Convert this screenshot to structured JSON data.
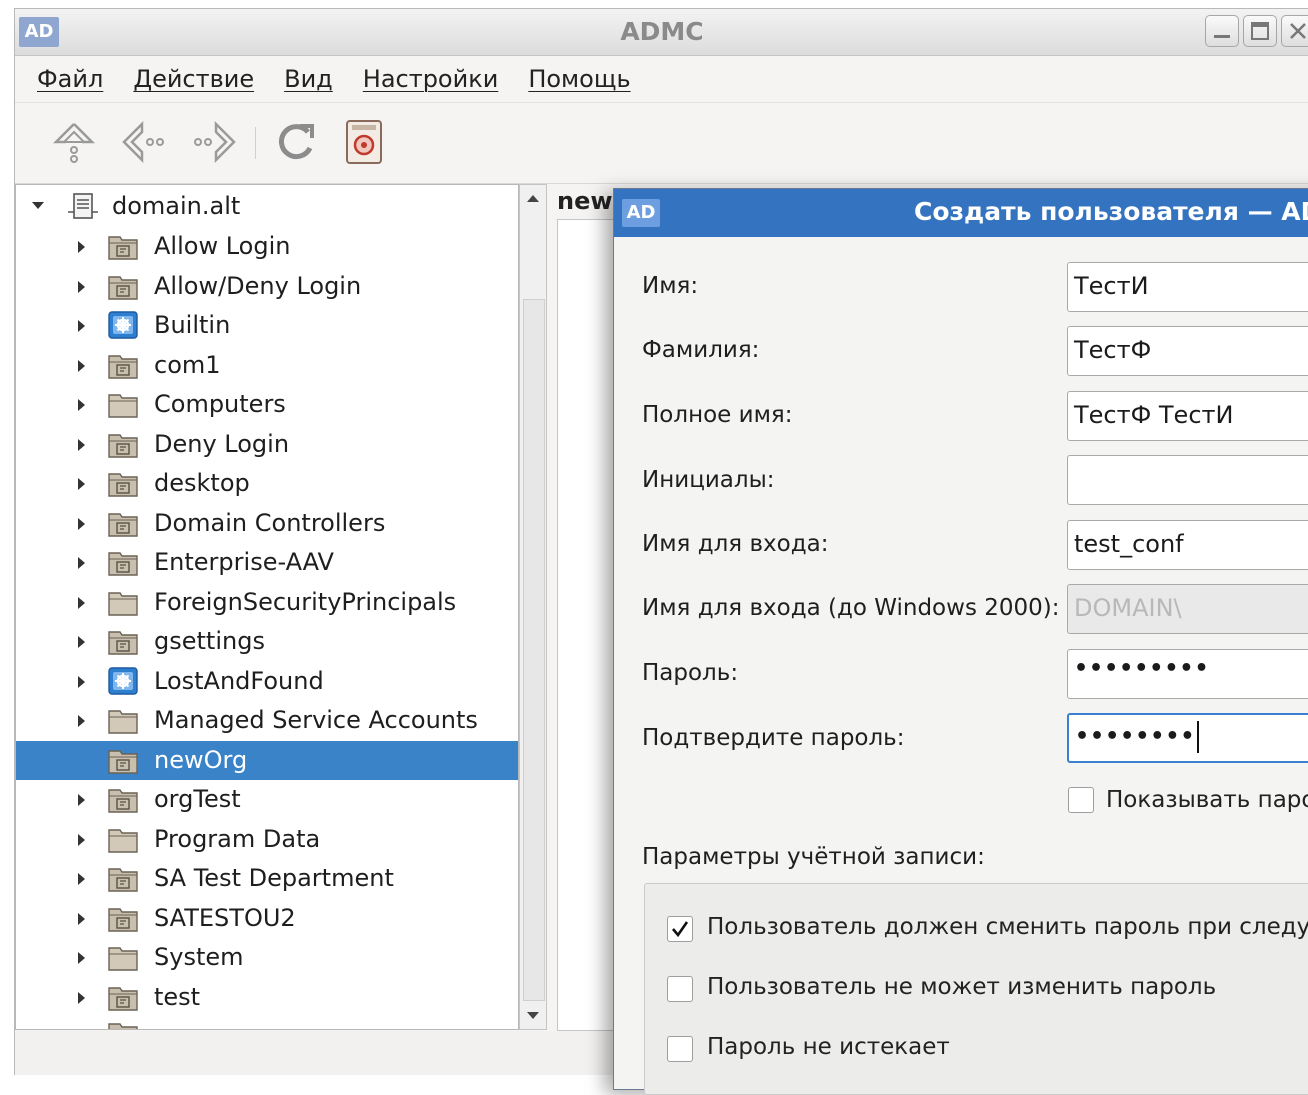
{
  "window": {
    "app_icon": "AD",
    "title": "ADMC",
    "controls": [
      "minimize-icon",
      "maximize-icon",
      "close-icon"
    ]
  },
  "menu": [
    "Файл",
    "Действие",
    "Вид",
    "Настройки",
    "Помощь"
  ],
  "toolbar": {
    "buttons": [
      "up-icon",
      "back-icon",
      "forward-icon",
      "refresh-icon",
      "filter-icon"
    ]
  },
  "tree": {
    "root": "domain.alt",
    "items": [
      {
        "label": "Allow Login",
        "icon": "ou-folder-icon"
      },
      {
        "label": "Allow/Deny Login",
        "icon": "ou-folder-icon"
      },
      {
        "label": "Builtin",
        "icon": "builtin-container-icon"
      },
      {
        "label": "com1",
        "icon": "ou-folder-icon"
      },
      {
        "label": "Computers",
        "icon": "folder-icon"
      },
      {
        "label": "Deny Login",
        "icon": "ou-folder-icon"
      },
      {
        "label": "desktop",
        "icon": "ou-folder-icon"
      },
      {
        "label": "Domain Controllers",
        "icon": "ou-folder-icon"
      },
      {
        "label": "Enterprise-AAV",
        "icon": "ou-folder-icon"
      },
      {
        "label": "ForeignSecurityPrincipals",
        "icon": "folder-icon"
      },
      {
        "label": "gsettings",
        "icon": "ou-folder-icon"
      },
      {
        "label": "LostAndFound",
        "icon": "builtin-container-icon"
      },
      {
        "label": "Managed Service Accounts",
        "icon": "folder-icon"
      },
      {
        "label": "newOrg",
        "icon": "ou-folder-icon",
        "selected": true
      },
      {
        "label": "orgTest",
        "icon": "ou-folder-icon"
      },
      {
        "label": "Program Data",
        "icon": "folder-icon"
      },
      {
        "label": "SA Test Department",
        "icon": "ou-folder-icon"
      },
      {
        "label": "SATESTOU2",
        "icon": "ou-folder-icon"
      },
      {
        "label": "System",
        "icon": "folder-icon"
      },
      {
        "label": "test",
        "icon": "ou-folder-icon"
      }
    ]
  },
  "right_pane": {
    "title": "new("
  },
  "dialog": {
    "app_icon": "AD",
    "title": "Создать пользователя — AD",
    "fields": {
      "first_name": {
        "label": "Имя:",
        "value": "ТестИ"
      },
      "last_name": {
        "label": "Фамилия:",
        "value": "ТестФ"
      },
      "full_name": {
        "label": "Полное имя:",
        "value": "ТестФ ТестИ"
      },
      "initials": {
        "label": "Инициалы:",
        "value": ""
      },
      "logon_name": {
        "label": "Имя для входа:",
        "value": "test_conf"
      },
      "logon_name_pre2000": {
        "label": "Имя для входа (до Windows 2000):",
        "value": "DOMAIN\\"
      },
      "password": {
        "label": "Пароль:",
        "value": "•••••••••"
      },
      "confirm_password": {
        "label": "Подтвердите пароль:",
        "value": "••••••••"
      }
    },
    "show_password": {
      "label": "Показывать паро",
      "checked": false
    },
    "account_options_title": "Параметры учётной записи:",
    "account_options": [
      {
        "label": "Пользователь должен сменить пароль при следу",
        "checked": true
      },
      {
        "label": "Пользователь не может изменить пароль",
        "checked": false
      },
      {
        "label": "Пароль не истекает",
        "checked": false
      }
    ]
  },
  "colors": {
    "selection": "#3a83c8",
    "dialog_titlebar": "#3373c0",
    "folder": "#b8ab97"
  }
}
